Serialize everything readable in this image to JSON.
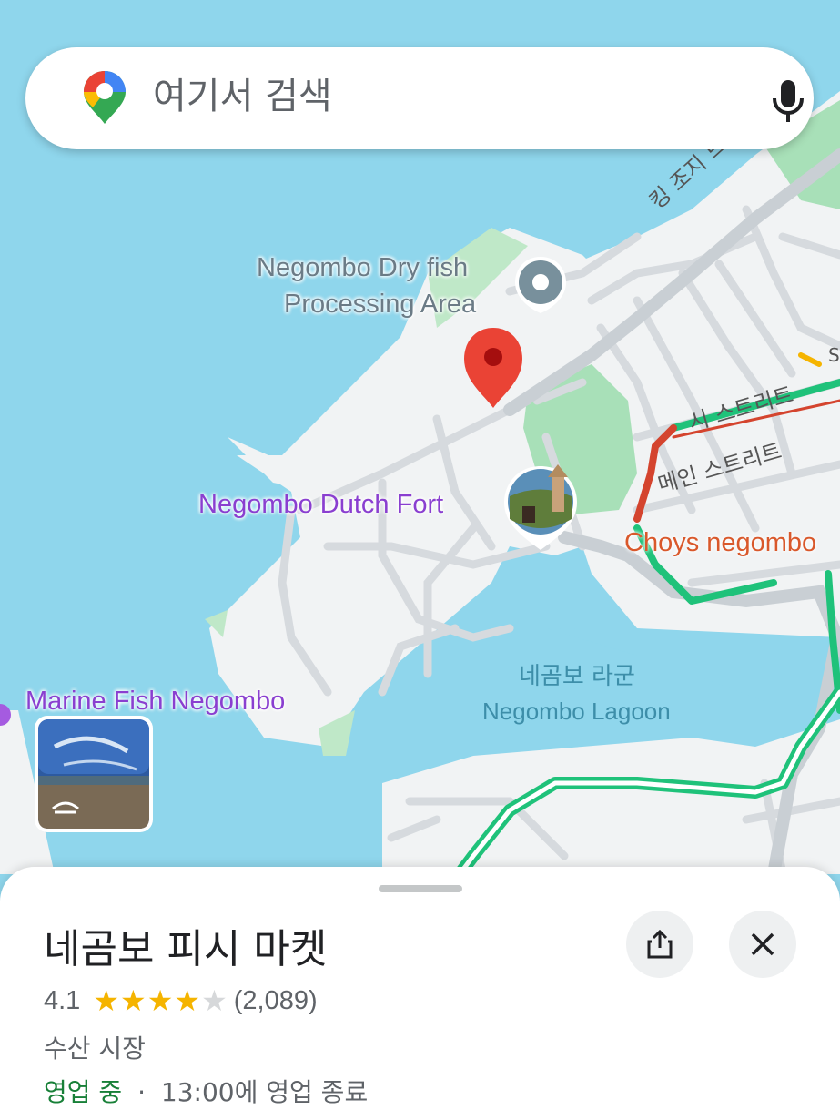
{
  "search": {
    "placeholder": "여기서 검색"
  },
  "map": {
    "labels": {
      "dry_fish": [
        "Negombo Dry fish",
        "Processing Area"
      ],
      "dutch_fort": "Negombo Dutch Fort",
      "choys": "Choys negombo",
      "lagoon_ko": "네곰보 라군",
      "lagoon_en": "Negombo Lagoon",
      "marine_fish": "Marine Fish Negombo",
      "king_george_drive": "킹 조지 드라이브",
      "sea_street": "시 스트리트",
      "main_street": "메인 스트리트",
      "sea_street_partial": "S"
    }
  },
  "place": {
    "title": "네곰보 피시 마켓",
    "rating": "4.1",
    "stars_filled": 4.1,
    "reviews": "(2,089)",
    "category": "수산 시장",
    "status": "영업 중",
    "separator": "·",
    "hours": "13:00에 영업 종료"
  },
  "icons": {
    "share": "share-icon",
    "close": "close-icon",
    "mic": "mic-icon",
    "maps_logo": "google-maps-logo"
  },
  "colors": {
    "water": "#8fd6ec",
    "land": "#f1f3f4",
    "park": "#a8e0b8",
    "traffic_green": "#1fc27a",
    "traffic_red": "#d4442e",
    "pin_red": "#ea4335",
    "open_green": "#188038",
    "star": "#f5b400"
  }
}
